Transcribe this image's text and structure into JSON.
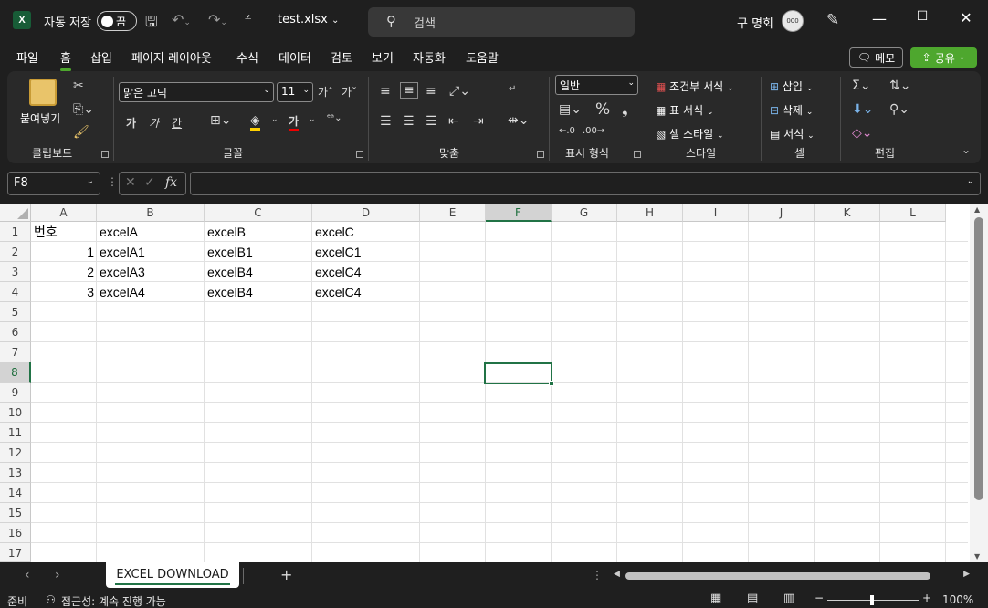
{
  "titlebar": {
    "app_logo": "X",
    "autosave_label": "자동 저장",
    "autosave_state": "끔",
    "file_name": "test.xlsx",
    "search_placeholder": "검색",
    "user_name": "구 명회",
    "avatar_text": "000"
  },
  "tabs": [
    "파일",
    "홈",
    "삽입",
    "페이지 레이아웃",
    "수식",
    "데이터",
    "검토",
    "보기",
    "자동화",
    "도움말"
  ],
  "active_tab": "홈",
  "memo_label": "메모",
  "share_label": "공유",
  "ribbon": {
    "clipboard": {
      "paste_label": "붙여넣기",
      "group_label": "클립보드"
    },
    "font": {
      "font_name": "맑은 고딕",
      "font_size": "11",
      "bold": "가",
      "italic": "가",
      "underline": "간",
      "font_color_glyph": "가",
      "group_label": "글꼴"
    },
    "alignment": {
      "group_label": "맞춤"
    },
    "number": {
      "format": "일반",
      "group_label": "표시 형식"
    },
    "styles": {
      "conditional": "조건부 서식",
      "table": "표 서식",
      "cell_style": "셀 스타일",
      "group_label": "스타일"
    },
    "cells": {
      "insert": "삽입",
      "delete": "삭제",
      "format": "서식",
      "group_label": "셀"
    },
    "editing": {
      "group_label": "편집"
    }
  },
  "formula_bar": {
    "name_box": "F8",
    "formula": ""
  },
  "columns": [
    "A",
    "B",
    "C",
    "D",
    "E",
    "F",
    "G",
    "H",
    "I",
    "J",
    "K",
    "L"
  ],
  "selected_column": "F",
  "rows": [
    "1",
    "2",
    "3",
    "4",
    "5",
    "6",
    "7",
    "8",
    "9",
    "10",
    "11",
    "12",
    "13",
    "14",
    "15",
    "16",
    "17"
  ],
  "selected_row": "8",
  "cells": {
    "A1": "번호",
    "B1": "excelA",
    "C1": "excelB",
    "D1": "excelC",
    "A2": "1",
    "B2": "excelA1",
    "C2": "excelB1",
    "D2": "excelC1",
    "A3": "2",
    "B3": "excelA3",
    "C3": "excelB4",
    "D3": "excelC4",
    "A4": "3",
    "B4": "excelA4",
    "C4": "excelB4",
    "D4": "excelC4"
  },
  "sheet_tabs": [
    "EXCEL DOWNLOAD"
  ],
  "status": {
    "ready": "준비",
    "accessibility": "접근성: 계속 진행 가능",
    "zoom": "100%"
  },
  "colors": {
    "accent": "#217346",
    "share_green": "#4ea72e"
  }
}
